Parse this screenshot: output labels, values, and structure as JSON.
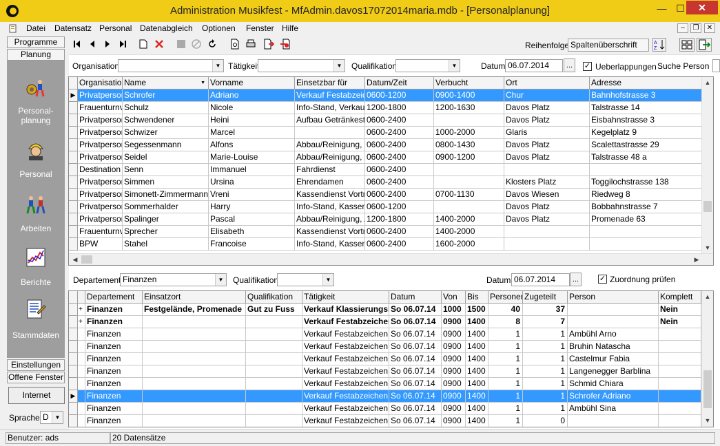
{
  "window": {
    "title": "Administration Musikfest - MfAdmin.davos17072014maria.mdb - [Personalplanung]",
    "min": "—",
    "max": "☐",
    "close": "✕"
  },
  "menu": {
    "items": [
      "Datei",
      "Datensatz",
      "Personal",
      "Datenabgleich",
      "Optionen",
      "Fenster",
      "Hilfe"
    ],
    "mdi_min": "–",
    "mdi_restore": "❐",
    "mdi_close": "✕"
  },
  "toolbar": {
    "reihenfolge_label": "Reihenfolge",
    "reihenfolge_value": "Spaltenüberschrift"
  },
  "filter": {
    "organisation_label": "Organisation",
    "organisation_value": "",
    "taetigkeit_label": "Tätigkeit",
    "taetigkeit_value": "",
    "qualifikation_label": "Qualifikation",
    "qualifikation_value": "",
    "datum_label": "Datum",
    "datum_value": "06.07.2014",
    "dots": "...",
    "ueberlappungen_label": "Ueberlappungen",
    "ueberlappungen_checked": "✓",
    "suche_label": "Suche Person"
  },
  "nav": {
    "tab_programme": "Programme",
    "tab_planung": "Planung",
    "personalplanung_line1": "Personal-",
    "personalplanung_line2": "planung",
    "personal": "Personal",
    "arbeiten": "Arbeiten",
    "berichte": "Berichte",
    "stammdaten": "Stammdaten",
    "tab_einstellungen": "Einstellungen",
    "tab_offene_fenster": "Offene Fenster",
    "internet": "Internet",
    "sprache_label": "Sprache",
    "sprache_value": "D"
  },
  "upper_grid": {
    "columns": [
      "Organisation",
      "Name",
      "Vorname",
      "Einsetzbar für",
      "Datum/Zeit",
      "Verbucht",
      "Ort",
      "Adresse"
    ],
    "sort_indicator": "▼",
    "rows": [
      [
        "Privatperson",
        "Schrofer",
        "Adriano",
        "Verkauf Festabzeichen",
        "0600-1200",
        "0900-1400",
        "Chur",
        "Bahnhofstrasse 3"
      ],
      [
        "Frauenturnverein",
        "Schulz",
        "Nicole",
        "Info-Stand, Verkauf Festabzeichen",
        "1200-1800",
        "1200-1630",
        "Davos Platz",
        "Talstrasse 14"
      ],
      [
        "Privatperson",
        "Schwendener",
        "Heini",
        "Aufbau Getränkestände",
        "0600-2400",
        "",
        "Davos Platz",
        "Eisbahnstrasse 3"
      ],
      [
        "Privatperson",
        "Schwizer",
        "Marcel",
        "",
        "0600-2400",
        "1000-2000",
        "Glaris",
        "Kegelplatz 9"
      ],
      [
        "Privatperson",
        "Segessenmann",
        "Alfons",
        "Abbau/Reinigung, Info-Stand",
        "0600-2400",
        "0800-1430",
        "Davos Platz",
        "Scalettastrasse 29"
      ],
      [
        "Privatperson",
        "Seidel",
        "Marie-Louise",
        "Abbau/Reinigung, Info-Stand",
        "0600-2400",
        "0900-1200",
        "Davos Platz",
        "Talstrasse 48 a"
      ],
      [
        "Destination Davos",
        "Senn",
        "Immanuel",
        "Fahrdienst",
        "0600-2400",
        "",
        "",
        ""
      ],
      [
        "Privatperson",
        "Simmen",
        "Ursina",
        "Ehrendamen",
        "0600-2400",
        "",
        "Klosters Platz",
        "Toggilochstrasse 138"
      ],
      [
        "Privatperson",
        "Simonett-Zimmermann",
        "Vreni",
        "Kassendienst Vorträge",
        "0600-2400",
        "0700-1130",
        "Davos Wiesen",
        "Riedweg 8"
      ],
      [
        "Privatperson",
        "Sommerhalder",
        "Harry",
        "Info-Stand, Kassendienst",
        "0600-1200",
        "",
        "Davos Platz",
        "Bobbahnstrasse 7"
      ],
      [
        "Privatperson",
        "Spalinger",
        "Pascal",
        "Abbau/Reinigung, Aufbau",
        "1200-1800",
        "1400-2000",
        "Davos Platz",
        "Promenade 63"
      ],
      [
        "Frauenturnverein",
        "Sprecher",
        "Elisabeth",
        "Kassendienst Vorträge",
        "0600-2400",
        "1400-2000",
        "",
        ""
      ],
      [
        "BPW",
        "Stahel",
        "Francoise",
        "Info-Stand, Kassendienst",
        "0600-2400",
        "1600-2000",
        "",
        ""
      ]
    ]
  },
  "lower_filter": {
    "departement_label": "Departement",
    "departement_value": "Finanzen",
    "qualifikation_label": "Qualifikation",
    "qualifikation_value": "",
    "datum_label": "Datum",
    "datum_value": "06.07.2014",
    "dots": "...",
    "zuordnung_label": "Zuordnung prüfen",
    "zuordnung_checked": "✓"
  },
  "lower_grid": {
    "columns": [
      "Departement",
      "Einsatzort",
      "Qualifikation",
      "Tätigkeit",
      "Datum",
      "Von",
      "Bis",
      "Personen",
      "Zugeteilt",
      "Person",
      "Komplett"
    ],
    "rows": [
      {
        "exp": "+",
        "bold": true,
        "cells": [
          "Finanzen",
          "Festgelände, Promenade",
          "Gut zu Fuss",
          "Verkauf Klassierungsblätter",
          "So 06.07.14",
          "1000",
          "1500",
          "40",
          "37",
          "",
          "Nein"
        ]
      },
      {
        "exp": "+",
        "bold": true,
        "cells": [
          "Finanzen",
          "",
          "",
          "Verkauf Festabzeichen",
          "So 06.07.14",
          "0900",
          "1400",
          "8",
          "7",
          "",
          "Nein"
        ]
      },
      {
        "exp": "",
        "bold": false,
        "cells": [
          "Finanzen",
          "",
          "",
          "Verkauf Festabzeichen",
          "So 06.07.14",
          "0900",
          "1400",
          "1",
          "1",
          "Ambühl Arno",
          ""
        ]
      },
      {
        "exp": "",
        "bold": false,
        "cells": [
          "Finanzen",
          "",
          "",
          "Verkauf Festabzeichen",
          "So 06.07.14",
          "0900",
          "1400",
          "1",
          "1",
          "Bruhin Natascha",
          ""
        ]
      },
      {
        "exp": "",
        "bold": false,
        "cells": [
          "Finanzen",
          "",
          "",
          "Verkauf Festabzeichen",
          "So 06.07.14",
          "0900",
          "1400",
          "1",
          "1",
          "Castelmur Fabia",
          ""
        ]
      },
      {
        "exp": "",
        "bold": false,
        "cells": [
          "Finanzen",
          "",
          "",
          "Verkauf Festabzeichen",
          "So 06.07.14",
          "0900",
          "1400",
          "1",
          "1",
          "Langenegger Barblina",
          ""
        ]
      },
      {
        "exp": "",
        "bold": false,
        "cells": [
          "Finanzen",
          "",
          "",
          "Verkauf Festabzeichen",
          "So 06.07.14",
          "0900",
          "1400",
          "1",
          "1",
          "Schmid Chiara",
          ""
        ]
      },
      {
        "exp": "",
        "bold": false,
        "cells": [
          "Finanzen",
          "",
          "",
          "Verkauf Festabzeichen",
          "So 06.07.14",
          "0900",
          "1400",
          "1",
          "1",
          "Schrofer Adriano",
          ""
        ]
      },
      {
        "exp": "",
        "bold": false,
        "cells": [
          "Finanzen",
          "",
          "",
          "Verkauf Festabzeichen",
          "So 06.07.14",
          "0900",
          "1400",
          "1",
          "1",
          "Ambühl Sina",
          ""
        ]
      },
      {
        "exp": "",
        "bold": false,
        "cells": [
          "Finanzen",
          "",
          "",
          "Verkauf Festabzeichen",
          "So 06.07.14",
          "0900",
          "1400",
          "1",
          "0",
          "",
          ""
        ]
      }
    ]
  },
  "status": {
    "user": "Benutzer: ads",
    "records": "20 Datensätze"
  },
  "colors": {
    "selection": "#3399ff",
    "titlebar": "#f0cc16",
    "nav_panel": "#9e9e9e"
  }
}
